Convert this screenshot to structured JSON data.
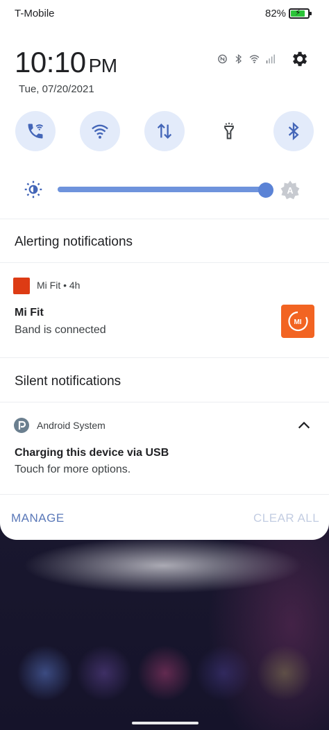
{
  "status_bar": {
    "carrier": "T-Mobile",
    "battery_percent": "82%",
    "battery_level": 0.82
  },
  "header": {
    "time": "10:10",
    "ampm": "PM",
    "date": "Tue, 07/20/2021",
    "status_icons": [
      "nfc-icon",
      "bluetooth-icon",
      "wifi-icon",
      "signal-icon"
    ]
  },
  "quick_tiles": [
    {
      "name": "wifi-calling",
      "icon": "phone-wifi-icon",
      "on": true
    },
    {
      "name": "wifi",
      "icon": "wifi-icon",
      "on": true
    },
    {
      "name": "mobile-data",
      "icon": "data-arrows-icon",
      "on": true
    },
    {
      "name": "flashlight",
      "icon": "flashlight-icon",
      "on": false
    },
    {
      "name": "bluetooth",
      "icon": "bluetooth-icon",
      "on": true
    }
  ],
  "brightness": {
    "level": 1.0,
    "accent": "#5b83d6"
  },
  "sections": {
    "alerting": "Alerting notifications",
    "silent": "Silent notifications"
  },
  "notifications": [
    {
      "app": "Mi Fit",
      "time": "4h",
      "meta": "Mi Fit • 4h",
      "title": "Mi Fit",
      "text": "Band is connected",
      "thumb_label": "MI",
      "app_color": "#dd3b14"
    },
    {
      "app": "Android System",
      "title": "Charging this device via USB",
      "text": "Touch for more options."
    }
  ],
  "footer": {
    "manage": "MANAGE",
    "clear_all": "CLEAR ALL"
  }
}
